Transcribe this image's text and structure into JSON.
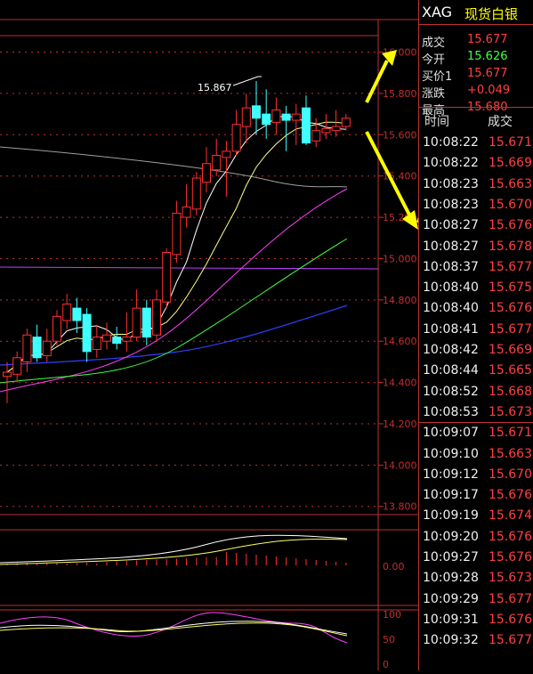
{
  "instrument": {
    "symbol": "XAG",
    "name": "现货白银"
  },
  "quote": [
    {
      "label": "成交",
      "value": "15.677",
      "color": "#ff4040"
    },
    {
      "label": "今开",
      "value": "15.626",
      "color": "#40ff40"
    },
    {
      "label": "买价1",
      "value": "15.677",
      "color": "#ff4040"
    },
    {
      "label": "涨跌",
      "value": "+0.049",
      "color": "#ff4040"
    },
    {
      "label": "最高",
      "value": "15.680",
      "color": "#ff4040"
    }
  ],
  "trades_header": {
    "time": "时间",
    "price": "成交"
  },
  "trades": [
    {
      "time": "10:08:22",
      "price": "15.671"
    },
    {
      "time": "10:08:22",
      "price": "15.669"
    },
    {
      "time": "10:08:23",
      "price": "15.663"
    },
    {
      "time": "10:08:23",
      "price": "15.670"
    },
    {
      "time": "10:08:27",
      "price": "15.676"
    },
    {
      "time": "10:08:27",
      "price": "15.678"
    },
    {
      "time": "10:08:37",
      "price": "15.677"
    },
    {
      "time": "10:08:40",
      "price": "15.675"
    },
    {
      "time": "10:08:40",
      "price": "15.676"
    },
    {
      "time": "10:08:41",
      "price": "15.677"
    },
    {
      "time": "10:08:42",
      "price": "15.669"
    },
    {
      "time": "10:08:44",
      "price": "15.665"
    },
    {
      "time": "10:08:52",
      "price": "15.668"
    },
    {
      "time": "10:08:53",
      "price": "15.673"
    },
    {
      "time": "10:09:07",
      "price": "15.671"
    },
    {
      "time": "10:09:10",
      "price": "15.663"
    },
    {
      "time": "10:09:12",
      "price": "15.670"
    },
    {
      "time": "10:09:17",
      "price": "15.676"
    },
    {
      "time": "10:09:19",
      "price": "15.674"
    },
    {
      "time": "10:09:20",
      "price": "15.676"
    },
    {
      "time": "10:09:27",
      "price": "15.676"
    },
    {
      "time": "10:09:28",
      "price": "15.673"
    },
    {
      "time": "10:09:29",
      "price": "15.677"
    },
    {
      "time": "10:09:31",
      "price": "15.676"
    },
    {
      "time": "10:09:32",
      "price": "15.677"
    }
  ],
  "chart_data": {
    "type": "candlestick",
    "y_ticks": [
      "16.000",
      "15.800",
      "15.600",
      "15.400",
      "15.200",
      "15.000",
      "14.800",
      "14.600",
      "14.400",
      "14.200",
      "14.000",
      "13.800"
    ],
    "ylim": [
      13.76,
      16.08
    ],
    "high_marker": "15.867",
    "macd_ticks": [
      "0.00"
    ],
    "kdj_ticks": [
      "100",
      "50",
      "0"
    ],
    "candles": [
      {
        "o": 14.43,
        "c": 14.45,
        "h": 14.5,
        "l": 14.3
      },
      {
        "o": 14.44,
        "c": 14.52,
        "h": 14.55,
        "l": 14.4
      },
      {
        "o": 14.5,
        "c": 14.63,
        "h": 14.66,
        "l": 14.45
      },
      {
        "o": 14.62,
        "c": 14.52,
        "h": 14.68,
        "l": 14.5
      },
      {
        "o": 14.53,
        "c": 14.6,
        "h": 14.66,
        "l": 14.5
      },
      {
        "o": 14.6,
        "c": 14.72,
        "h": 14.75,
        "l": 14.58
      },
      {
        "o": 14.7,
        "c": 14.78,
        "h": 14.83,
        "l": 14.66
      },
      {
        "o": 14.76,
        "c": 14.7,
        "h": 14.81,
        "l": 14.64
      },
      {
        "o": 14.73,
        "c": 14.55,
        "h": 14.76,
        "l": 14.5
      },
      {
        "o": 14.56,
        "c": 14.62,
        "h": 14.68,
        "l": 14.52
      },
      {
        "o": 14.6,
        "c": 14.63,
        "h": 14.69,
        "l": 14.56
      },
      {
        "o": 14.62,
        "c": 14.59,
        "h": 14.67,
        "l": 14.56
      },
      {
        "o": 14.6,
        "c": 14.62,
        "h": 14.74,
        "l": 14.55
      },
      {
        "o": 14.62,
        "c": 14.76,
        "h": 14.85,
        "l": 14.6
      },
      {
        "o": 14.76,
        "c": 14.62,
        "h": 14.8,
        "l": 14.58
      },
      {
        "o": 14.63,
        "c": 14.8,
        "h": 14.85,
        "l": 14.6
      },
      {
        "o": 14.79,
        "c": 15.03,
        "h": 15.05,
        "l": 14.76
      },
      {
        "o": 15.02,
        "c": 15.22,
        "h": 15.28,
        "l": 14.98
      },
      {
        "o": 15.2,
        "c": 15.25,
        "h": 15.36,
        "l": 15.15
      },
      {
        "o": 15.24,
        "c": 15.39,
        "h": 15.42,
        "l": 15.21
      },
      {
        "o": 15.37,
        "c": 15.46,
        "h": 15.54,
        "l": 15.32
      },
      {
        "o": 15.43,
        "c": 15.5,
        "h": 15.58,
        "l": 15.4
      },
      {
        "o": 15.49,
        "c": 15.52,
        "h": 15.57,
        "l": 15.3
      },
      {
        "o": 15.52,
        "c": 15.65,
        "h": 15.72,
        "l": 15.5
      },
      {
        "o": 15.64,
        "c": 15.73,
        "h": 15.8,
        "l": 15.56
      },
      {
        "o": 15.74,
        "c": 15.68,
        "h": 15.86,
        "l": 15.6
      },
      {
        "o": 15.7,
        "c": 15.65,
        "h": 15.82,
        "l": 15.58
      },
      {
        "o": 15.66,
        "c": 15.72,
        "h": 15.78,
        "l": 15.6
      },
      {
        "o": 15.7,
        "c": 15.67,
        "h": 15.74,
        "l": 15.52
      },
      {
        "o": 15.67,
        "c": 15.7,
        "h": 15.75,
        "l": 15.55
      },
      {
        "o": 15.73,
        "c": 15.56,
        "h": 15.79,
        "l": 15.55
      },
      {
        "o": 15.57,
        "c": 15.62,
        "h": 15.68,
        "l": 15.54
      },
      {
        "o": 15.61,
        "c": 15.63,
        "h": 15.7,
        "l": 15.58
      },
      {
        "o": 15.62,
        "c": 15.64,
        "h": 15.72,
        "l": 15.59
      },
      {
        "o": 15.64,
        "c": 15.68,
        "h": 15.7,
        "l": 15.62
      }
    ]
  },
  "colors": {
    "up": "#ff3030",
    "down": "#40ffff",
    "grid": "#c03030",
    "arrow": "#ffff00"
  }
}
